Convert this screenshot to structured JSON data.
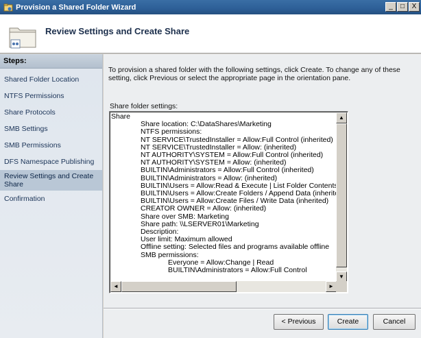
{
  "window": {
    "title": "Provision a Shared Folder Wizard",
    "minimize": "_",
    "maximize": "□",
    "close": "X"
  },
  "header": {
    "title": "Review Settings and Create Share"
  },
  "steps": {
    "heading": "Steps:",
    "items": [
      {
        "label": "Shared Folder Location"
      },
      {
        "label": "NTFS Permissions"
      },
      {
        "label": "Share Protocols"
      },
      {
        "label": "SMB Settings"
      },
      {
        "label": "SMB Permissions"
      },
      {
        "label": "DFS Namespace Publishing"
      },
      {
        "label": "Review Settings and Create Share"
      },
      {
        "label": "Confirmation"
      }
    ],
    "active_index": 6
  },
  "main": {
    "intro": "To provision a shared folder with the following settings, click Create. To change any of these setting, click Previous or select the appropriate page in the orientation pane.",
    "settings_label": "Share folder settings:",
    "settings_lines": [
      {
        "indent": 0,
        "text": "Share"
      },
      {
        "indent": 1,
        "text": "Share location: C:\\DataShares\\Marketing"
      },
      {
        "indent": 1,
        "text": "NTFS permissions:"
      },
      {
        "indent": 2,
        "text": "NT SERVICE\\TrustedInstaller = Allow:Full Control (inherited)"
      },
      {
        "indent": 2,
        "text": "NT SERVICE\\TrustedInstaller = Allow: (inherited)"
      },
      {
        "indent": 2,
        "text": "NT AUTHORITY\\SYSTEM = Allow:Full Control (inherited)"
      },
      {
        "indent": 2,
        "text": "NT AUTHORITY\\SYSTEM = Allow: (inherited)"
      },
      {
        "indent": 2,
        "text": "BUILTIN\\Administrators = Allow:Full Control (inherited)"
      },
      {
        "indent": 2,
        "text": "BUILTIN\\Administrators = Allow: (inherited)"
      },
      {
        "indent": 2,
        "text": "BUILTIN\\Users = Allow:Read & Execute | List Folder Contents | R"
      },
      {
        "indent": 2,
        "text": "BUILTIN\\Users = Allow:Create Folders / Append Data (inherited)"
      },
      {
        "indent": 2,
        "text": "BUILTIN\\Users = Allow:Create Files / Write Data (inherited)"
      },
      {
        "indent": 2,
        "text": "CREATOR OWNER = Allow: (inherited)"
      },
      {
        "indent": 1,
        "text": "Share over SMB: Marketing"
      },
      {
        "indent": 2,
        "text": "Share path: \\\\LSERVER01\\Marketing"
      },
      {
        "indent": 2,
        "text": "Description:"
      },
      {
        "indent": 2,
        "text": "User limit: Maximum allowed"
      },
      {
        "indent": 2,
        "text": "Offline setting: Selected files and programs available offline"
      },
      {
        "indent": 2,
        "text": "SMB permissions:"
      },
      {
        "indent": 3,
        "text": "Everyone = Allow:Change | Read"
      },
      {
        "indent": 3,
        "text": "BUILTIN\\Administrators = Allow:Full Control"
      }
    ]
  },
  "buttons": {
    "previous": "< Previous",
    "create": "Create",
    "cancel": "Cancel"
  },
  "scroll": {
    "up": "▲",
    "down": "▼",
    "left": "◄",
    "right": "►"
  },
  "icons": {
    "window_icon": "share-wizard-icon",
    "header_icon": "shared-folder-icon"
  }
}
